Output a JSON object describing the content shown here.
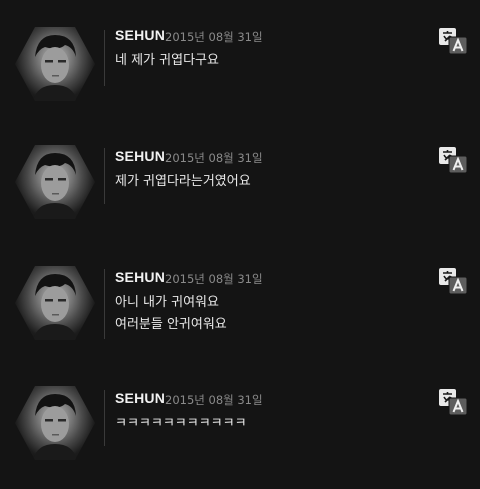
{
  "posts": [
    {
      "author": "SEHUN",
      "date": "2015년 08월 31일",
      "message": "네 제가 귀엽다구요",
      "translate_icon": "translate-icon"
    },
    {
      "author": "SEHUN",
      "date": "2015년 08월 31일",
      "message": "제가 귀엽다라는거였어요",
      "translate_icon": "translate-icon"
    },
    {
      "author": "SEHUN",
      "date": "2015년 08월 31일",
      "message": "아니 내가 귀여워요\n여러분들 안귀여워요",
      "translate_icon": "translate-icon"
    },
    {
      "author": "SEHUN",
      "date": "2015년 08월 31일",
      "message": "ㅋㅋㅋㅋㅋㅋㅋㅋㅋㅋㅋ",
      "translate_icon": "translate-icon"
    }
  ],
  "colors": {
    "background": "#141414",
    "name": "#f2f2f2",
    "date": "#8a8a8a",
    "message": "#e8e8e8"
  }
}
